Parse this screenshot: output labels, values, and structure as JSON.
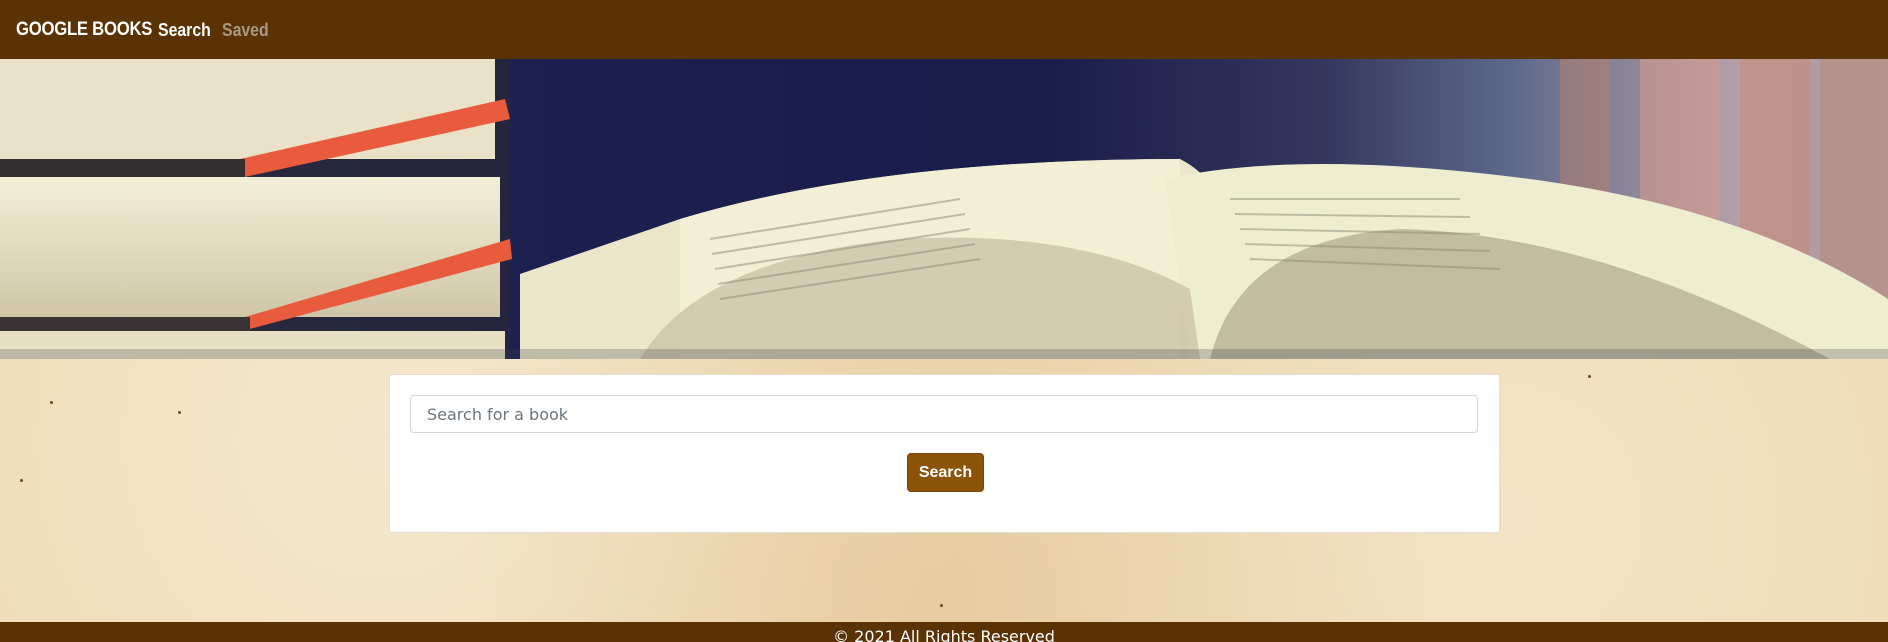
{
  "navbar": {
    "brand": "GOOGLE BOOKS",
    "links": [
      {
        "label": "Search",
        "active": true
      },
      {
        "label": "Saved",
        "active": false
      }
    ]
  },
  "search": {
    "placeholder": "Search for a book",
    "value": "",
    "button_label": "Search"
  },
  "footer": {
    "text": "© 2021 All Rights Reserved"
  },
  "colors": {
    "nav_bg": "#5a3203",
    "button_bg": "#8c5408",
    "page_bg": "#efd9b2"
  }
}
